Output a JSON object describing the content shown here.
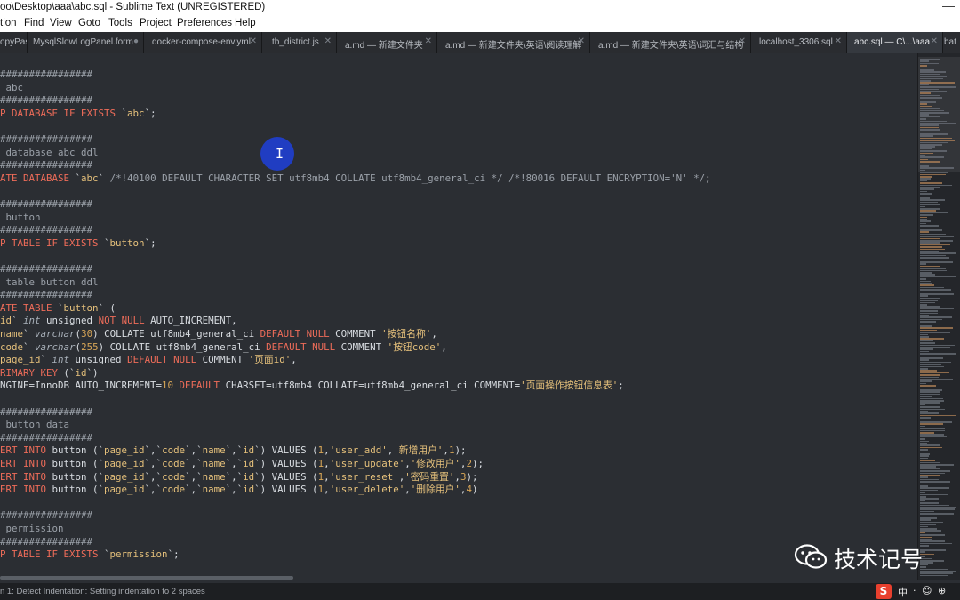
{
  "window": {
    "title": "oo\\Desktop\\aaa\\abc.sql - Sublime Text (UNREGISTERED)",
    "minimize_glyph": "—"
  },
  "menu": [
    "tion",
    "Find",
    "View",
    "Goto",
    "Tools",
    "Project",
    "Preferences",
    "Help"
  ],
  "tabs": [
    {
      "label": "opyPast",
      "close": ""
    },
    {
      "label": "MysqlSlowLogPanel.form",
      "close": "●"
    },
    {
      "label": "docker-compose-env.yml",
      "close": "✕"
    },
    {
      "label": "tb_district.js",
      "close": "✕"
    },
    {
      "label": "a.md — 新建文件夹",
      "close": "✕"
    },
    {
      "label": "a.md — 新建文件夹\\英语\\阅读理解",
      "close": "✕"
    },
    {
      "label": "a.md — 新建文件夹\\英语\\词汇与结构",
      "close": "✕"
    },
    {
      "label": "localhost_3306.sql",
      "close": "✕"
    },
    {
      "label": "abc.sql — C\\...\\aaa",
      "close": "✕"
    },
    {
      "label": "bat",
      "close": ""
    }
  ],
  "active_tab_index": 8,
  "code_lines": [
    [
      [
        "c",
        "################"
      ]
    ],
    [
      [
        "c",
        " abc"
      ]
    ],
    [
      [
        "c",
        "################"
      ]
    ],
    [
      [
        "k",
        "P DATABASE IF "
      ],
      [
        "k",
        "EXISTS"
      ],
      [
        "p",
        " `"
      ],
      [
        "s",
        "abc"
      ],
      [
        "p",
        "`;"
      ]
    ],
    [
      [
        "p",
        ""
      ]
    ],
    [
      [
        "c",
        "################"
      ]
    ],
    [
      [
        "c",
        " database abc ddl"
      ]
    ],
    [
      [
        "c",
        "################"
      ]
    ],
    [
      [
        "k",
        "ATE DATABASE "
      ],
      [
        "p",
        "`"
      ],
      [
        "s",
        "abc"
      ],
      [
        "p",
        "` "
      ],
      [
        "c",
        "/*!40100 DEFAULT CHARACTER SET utf8mb4 COLLATE utf8mb4_general_ci */ /*!80016 DEFAULT ENCRYPTION='N' */"
      ],
      [
        "p",
        ";"
      ]
    ],
    [
      [
        "p",
        ""
      ]
    ],
    [
      [
        "c",
        "################"
      ]
    ],
    [
      [
        "c",
        " button"
      ]
    ],
    [
      [
        "c",
        "################"
      ]
    ],
    [
      [
        "k",
        "P TABLE IF "
      ],
      [
        "k",
        "EXISTS"
      ],
      [
        "p",
        " `"
      ],
      [
        "s",
        "button"
      ],
      [
        "p",
        "`;"
      ]
    ],
    [
      [
        "p",
        ""
      ]
    ],
    [
      [
        "c",
        "################"
      ]
    ],
    [
      [
        "c",
        " table button ddl"
      ]
    ],
    [
      [
        "c",
        "################"
      ]
    ],
    [
      [
        "k",
        "ATE TABLE "
      ],
      [
        "p",
        "`"
      ],
      [
        "s",
        "button"
      ],
      [
        "p",
        "` ("
      ]
    ],
    [
      [
        "s",
        "id"
      ],
      [
        "p",
        "` "
      ],
      [
        "t",
        "int"
      ],
      [
        "p",
        " unsigned "
      ],
      [
        "k",
        "NOT NULL"
      ],
      [
        "p",
        " AUTO_INCREMENT,"
      ]
    ],
    [
      [
        "s",
        "name"
      ],
      [
        "p",
        "` "
      ],
      [
        "t",
        "varchar"
      ],
      [
        "p",
        "("
      ],
      [
        "n",
        "30"
      ],
      [
        "p",
        ") COLLATE utf8mb4_general_ci "
      ],
      [
        "k",
        "DEFAULT NULL"
      ],
      [
        "p",
        " COMMENT "
      ],
      [
        "s",
        "'按钮名称'"
      ],
      [
        "p",
        ","
      ]
    ],
    [
      [
        "s",
        "code"
      ],
      [
        "p",
        "` "
      ],
      [
        "t",
        "varchar"
      ],
      [
        "p",
        "("
      ],
      [
        "n",
        "255"
      ],
      [
        "p",
        ") COLLATE utf8mb4_general_ci "
      ],
      [
        "k",
        "DEFAULT NULL"
      ],
      [
        "p",
        " COMMENT "
      ],
      [
        "s",
        "'按钮code'"
      ],
      [
        "p",
        ","
      ]
    ],
    [
      [
        "s",
        "page_id"
      ],
      [
        "p",
        "` "
      ],
      [
        "t",
        "int"
      ],
      [
        "p",
        " unsigned "
      ],
      [
        "k",
        "DEFAULT NULL"
      ],
      [
        "p",
        " COMMENT "
      ],
      [
        "s",
        "'页面id'"
      ],
      [
        "p",
        ","
      ]
    ],
    [
      [
        "k",
        "RIMARY KEY"
      ],
      [
        "p",
        " (`"
      ],
      [
        "s",
        "id"
      ],
      [
        "p",
        "`)"
      ]
    ],
    [
      [
        "p",
        "NGINE=InnoDB AUTO_INCREMENT="
      ],
      [
        "n",
        "10"
      ],
      [
        "p",
        " "
      ],
      [
        "k",
        "DEFAULT"
      ],
      [
        "p",
        " CHARSET=utf8mb4 COLLATE=utf8mb4_general_ci COMMENT="
      ],
      [
        "s",
        "'页面操作按钮信息表'"
      ],
      [
        "p",
        ";"
      ]
    ],
    [
      [
        "p",
        ""
      ]
    ],
    [
      [
        "c",
        "################"
      ]
    ],
    [
      [
        "c",
        " button data"
      ]
    ],
    [
      [
        "c",
        "################"
      ]
    ],
    [
      [
        "k",
        "ERT INTO"
      ],
      [
        "p",
        " button (`"
      ],
      [
        "s",
        "page_id"
      ],
      [
        "p",
        "`,`"
      ],
      [
        "s",
        "code"
      ],
      [
        "p",
        "`,`"
      ],
      [
        "s",
        "name"
      ],
      [
        "p",
        "`,`"
      ],
      [
        "s",
        "id"
      ],
      [
        "p",
        "`) VALUES ("
      ],
      [
        "n",
        "1"
      ],
      [
        "p",
        ","
      ],
      [
        "s",
        "'user_add'"
      ],
      [
        "p",
        ","
      ],
      [
        "s",
        "'新增用户'"
      ],
      [
        "p",
        ","
      ],
      [
        "n",
        "1"
      ],
      [
        "p",
        ");"
      ]
    ],
    [
      [
        "k",
        "ERT INTO"
      ],
      [
        "p",
        " button (`"
      ],
      [
        "s",
        "page_id"
      ],
      [
        "p",
        "`,`"
      ],
      [
        "s",
        "code"
      ],
      [
        "p",
        "`,`"
      ],
      [
        "s",
        "name"
      ],
      [
        "p",
        "`,`"
      ],
      [
        "s",
        "id"
      ],
      [
        "p",
        "`) VALUES ("
      ],
      [
        "n",
        "1"
      ],
      [
        "p",
        ","
      ],
      [
        "s",
        "'user_update'"
      ],
      [
        "p",
        ","
      ],
      [
        "s",
        "'修改用户'"
      ],
      [
        "p",
        ","
      ],
      [
        "n",
        "2"
      ],
      [
        "p",
        ");"
      ]
    ],
    [
      [
        "k",
        "ERT INTO"
      ],
      [
        "p",
        " button (`"
      ],
      [
        "s",
        "page_id"
      ],
      [
        "p",
        "`,`"
      ],
      [
        "s",
        "code"
      ],
      [
        "p",
        "`,`"
      ],
      [
        "s",
        "name"
      ],
      [
        "p",
        "`,`"
      ],
      [
        "s",
        "id"
      ],
      [
        "p",
        "`) VALUES ("
      ],
      [
        "n",
        "1"
      ],
      [
        "p",
        ","
      ],
      [
        "s",
        "'user_reset'"
      ],
      [
        "p",
        ","
      ],
      [
        "s",
        "'密码重置'"
      ],
      [
        "p",
        ","
      ],
      [
        "n",
        "3"
      ],
      [
        "p",
        ");"
      ]
    ],
    [
      [
        "k",
        "ERT INTO"
      ],
      [
        "p",
        " button (`"
      ],
      [
        "s",
        "page_id"
      ],
      [
        "p",
        "`,`"
      ],
      [
        "s",
        "code"
      ],
      [
        "p",
        "`,`"
      ],
      [
        "s",
        "name"
      ],
      [
        "p",
        "`,`"
      ],
      [
        "s",
        "id"
      ],
      [
        "p",
        "`) VALUES ("
      ],
      [
        "n",
        "1"
      ],
      [
        "p",
        ","
      ],
      [
        "s",
        "'user_delete'"
      ],
      [
        "p",
        ","
      ],
      [
        "s",
        "'删除用户'"
      ],
      [
        "p",
        ","
      ],
      [
        "n",
        "4"
      ],
      [
        "p",
        ")"
      ]
    ],
    [
      [
        "p",
        ""
      ]
    ],
    [
      [
        "c",
        "################"
      ]
    ],
    [
      [
        "c",
        " permission"
      ]
    ],
    [
      [
        "c",
        "################"
      ]
    ],
    [
      [
        "k",
        "P TABLE IF "
      ],
      [
        "k",
        "EXISTS"
      ],
      [
        "p",
        " `"
      ],
      [
        "s",
        "permission"
      ],
      [
        "p",
        "`;"
      ]
    ]
  ],
  "colors": {
    "comment": "#9ba1a9",
    "keyword": "#ee6c59",
    "string": "#e5c07b",
    "type": "#a8b0b9",
    "plain": "#d9dde2",
    "number": "#d8a657",
    "editor_bg": "#2b2e33"
  },
  "cursor": {
    "glyph": "I"
  },
  "watermark": {
    "text": "技术记号",
    "icon": "wechat-icon"
  },
  "status": {
    "text": "n 1: Detect Indentation: Setting indentation to 2 spaces"
  },
  "ime": {
    "logo": "S",
    "items": [
      "中",
      "·",
      "☺",
      "⊕"
    ]
  }
}
